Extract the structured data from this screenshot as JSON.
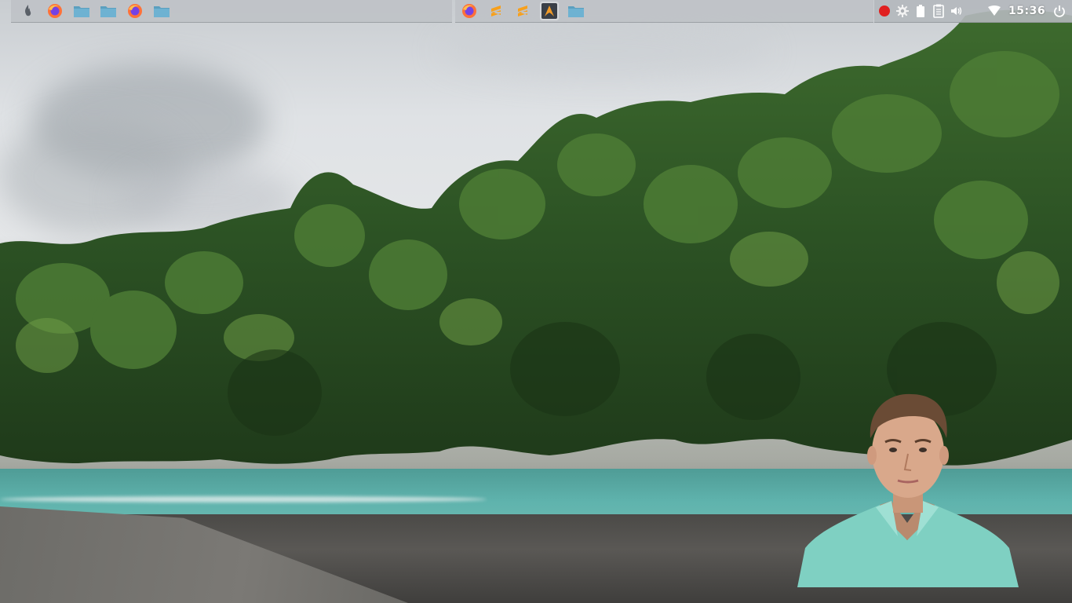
{
  "desktop": {
    "wallpaper": "coastal-forest-cliff-beach",
    "accent_color": "#e02020"
  },
  "taskbar": {
    "left_launchers": [
      {
        "name": "app-menu-icon"
      },
      {
        "name": "firefox-icon"
      },
      {
        "name": "folder-icon"
      },
      {
        "name": "folder-icon"
      },
      {
        "name": "firefox-icon"
      },
      {
        "name": "folder-icon"
      }
    ],
    "center_launchers": [
      {
        "name": "firefox-icon"
      },
      {
        "name": "sublime-text-icon"
      },
      {
        "name": "sublime-text-icon"
      },
      {
        "name": "arch-terminal-icon"
      },
      {
        "name": "folder-icon"
      }
    ],
    "tray": {
      "items": [
        "record-icon",
        "settings-gear-icon",
        "battery-icon",
        "clipboard-icon",
        "volume-icon",
        "wifi-icon"
      ],
      "clock": "15:36",
      "power": "power-icon"
    }
  },
  "webcam_overlay": {
    "visible": true
  }
}
